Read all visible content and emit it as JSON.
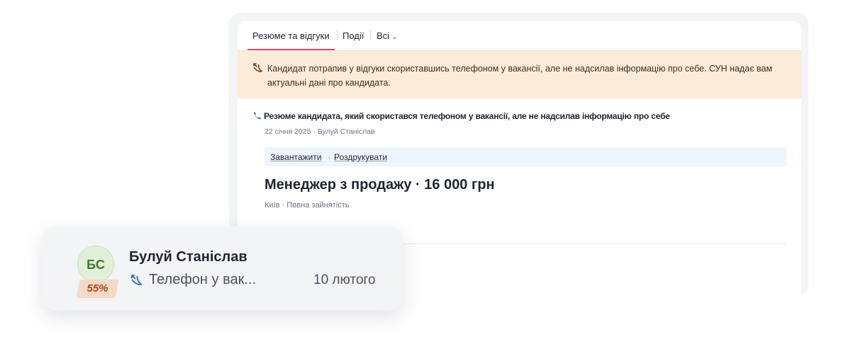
{
  "tabs": [
    {
      "label": "Резюме та відгуки",
      "active": true
    },
    {
      "label": "Події",
      "active": false
    },
    {
      "label": "Всі",
      "active": false
    }
  ],
  "notice": {
    "icon": "missed-call-icon",
    "text": "Кандидат потрапив у відгуки скориставшись телефоном у вакансії, але не надсилав інформацію про себе. СУН надає вам актуальні дані про кандидата."
  },
  "resume": {
    "icon": "phone-icon",
    "title": "Резюме кандидата, який скористався телефоном у вакансії, але не надсилав інформацію про себе",
    "meta": "22 січня 2025 · Булуй Станіслав",
    "actions": {
      "download": "Завантажити",
      "separator": "·",
      "print": "Роздрукувати"
    },
    "vacancy": "Менеджер з продажу · 16 000 грн",
    "vacancy_meta": "Київ · Повна зайнятість"
  },
  "candidate_card": {
    "initials": "БС",
    "score": "55%",
    "name": "Булуй Станіслав",
    "source_icon": "missed-call-icon",
    "source": "Телефон у вак...",
    "date": "10 лютого"
  },
  "colors": {
    "tab_underline": "#d94a6a",
    "notice_bg": "#fdebd9",
    "actions_bg": "#eef5fc",
    "avatar_bg": "#e3f0d9",
    "score_bg": "#f4d9c6",
    "score_text": "#a24a1a"
  }
}
